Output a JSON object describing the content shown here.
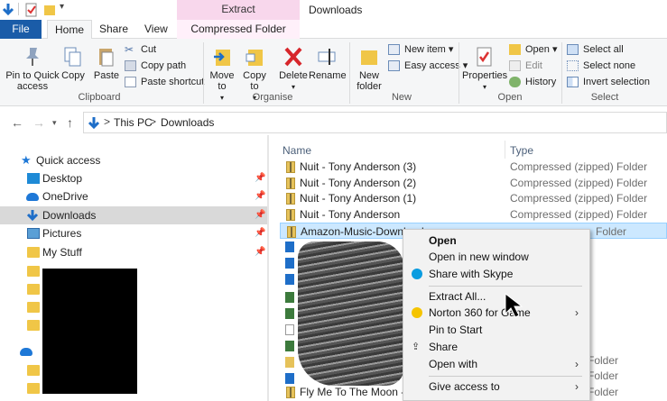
{
  "titlebar": {
    "context_tab": "Extract",
    "window_title": "Downloads"
  },
  "tabs": {
    "file": "File",
    "home": "Home",
    "share": "Share",
    "view": "View",
    "compressed": "Compressed Folder Tools"
  },
  "ribbon": {
    "clipboard": {
      "pin": "Pin to Quick access",
      "copy": "Copy",
      "paste": "Paste",
      "cut": "Cut",
      "copy_path": "Copy path",
      "paste_shortcut": "Paste shortcut",
      "label": "Clipboard"
    },
    "organise": {
      "move": "Move to",
      "copy": "Copy to",
      "delete": "Delete",
      "rename": "Rename",
      "label": "Organise"
    },
    "new": {
      "new_folder": "New folder",
      "new_item": "New item",
      "easy_access": "Easy access",
      "label": "New"
    },
    "open": {
      "properties": "Properties",
      "open": "Open",
      "edit": "Edit",
      "history": "History",
      "label": "Open"
    },
    "select": {
      "all": "Select all",
      "none": "Select none",
      "invert": "Invert selection",
      "label": "Select"
    }
  },
  "address": {
    "crumbs": [
      "This PC",
      "Downloads"
    ],
    "sep": ">"
  },
  "navpane": {
    "quick_access": "Quick access",
    "items": [
      "Desktop",
      "OneDrive",
      "Downloads",
      "Pictures",
      "My Stuff"
    ]
  },
  "filelist": {
    "headers": {
      "name": "Name",
      "type": "Type"
    },
    "rows": [
      {
        "name": "Nuit - Tony Anderson (3)",
        "type": "Compressed (zipped) Folder"
      },
      {
        "name": "Nuit - Tony Anderson (2)",
        "type": "Compressed (zipped) Folder"
      },
      {
        "name": "Nuit - Tony Anderson (1)",
        "type": "Compressed (zipped) Folder"
      },
      {
        "name": "Nuit - Tony Anderson",
        "type": "Compressed (zipped) Folder"
      },
      {
        "name": "Amazon-Music-Download",
        "type": "Folder"
      }
    ],
    "tail_type": "Folder",
    "last_row": "Fly Me To The Moon - Bol"
  },
  "context_menu": {
    "items": [
      "Open",
      "Open in new window",
      "Share with Skype",
      "Extract All...",
      "Norton 360 for Game",
      "Pin to Start",
      "Share",
      "Open with",
      "Give access to"
    ]
  },
  "colors": {
    "accent": "#1a5ca8",
    "selection": "#cce8ff",
    "context_tab": "#f8d7ec"
  }
}
